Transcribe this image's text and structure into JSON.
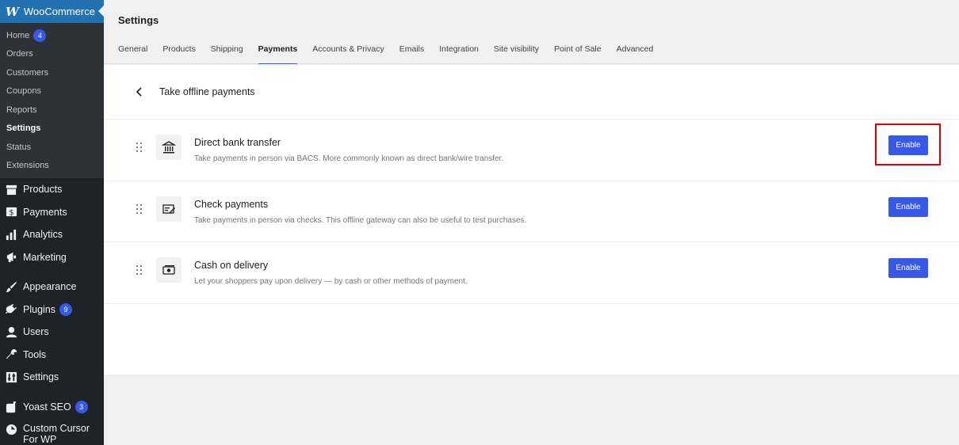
{
  "sidebar": {
    "woo_label": "WooCommerce",
    "woo_logo": "W",
    "sub_items": [
      {
        "label": "Home",
        "badge": "4"
      },
      {
        "label": "Orders"
      },
      {
        "label": "Customers"
      },
      {
        "label": "Coupons"
      },
      {
        "label": "Reports"
      },
      {
        "label": "Settings",
        "active": true
      },
      {
        "label": "Status"
      },
      {
        "label": "Extensions"
      }
    ],
    "items": [
      {
        "label": "Products",
        "icon": "archive-icon"
      },
      {
        "label": "Payments",
        "icon": "dollar-icon"
      },
      {
        "label": "Analytics",
        "icon": "bar-chart-icon"
      },
      {
        "label": "Marketing",
        "icon": "megaphone-icon"
      },
      {
        "label": "Appearance",
        "icon": "paintbrush-icon"
      },
      {
        "label": "Plugins",
        "icon": "plug-icon",
        "badge": "9"
      },
      {
        "label": "Users",
        "icon": "user-icon"
      },
      {
        "label": "Tools",
        "icon": "wrench-icon"
      },
      {
        "label": "Settings",
        "icon": "sliders-icon"
      },
      {
        "label": "Yoast SEO",
        "icon": "yoast-icon",
        "badge": "3"
      },
      {
        "label": "Custom Cursor For WP",
        "icon": "cursor-icon"
      }
    ]
  },
  "header": {
    "title": "Settings",
    "tabs": [
      "General",
      "Products",
      "Shipping",
      "Payments",
      "Accounts & Privacy",
      "Emails",
      "Integration",
      "Site visibility",
      "Point of Sale",
      "Advanced"
    ],
    "active_tab": "Payments"
  },
  "panel": {
    "back_title": "Take offline payments",
    "gateways": [
      {
        "title": "Direct bank transfer",
        "description": "Take payments in person via BACS. More commonly known as direct bank/wire transfer.",
        "button": "Enable",
        "icon": "bank-icon"
      },
      {
        "title": "Check payments",
        "description": "Take payments in person via checks. This offline gateway can also be useful to test purchases.",
        "button": "Enable",
        "icon": "check-icon"
      },
      {
        "title": "Cash on delivery",
        "description": "Let your shoppers pay upon delivery — by cash or other methods of payment.",
        "button": "Enable",
        "icon": "cash-icon"
      }
    ]
  },
  "colors": {
    "accent": "#3858e9",
    "sidebar_bg": "#1d2327",
    "highlight": "#e00000"
  }
}
